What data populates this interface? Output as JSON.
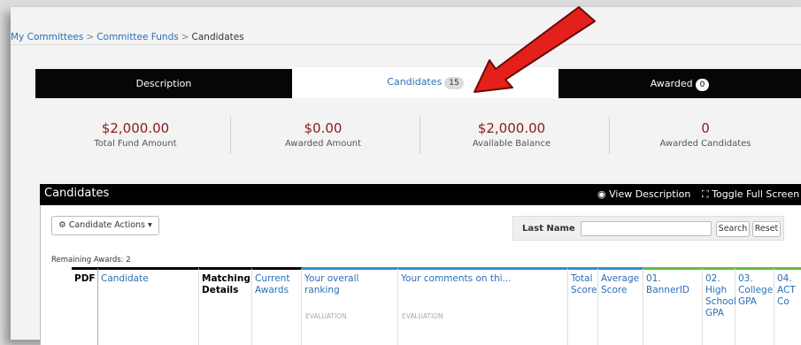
{
  "breadcrumb": {
    "items": [
      "My Committees",
      "Committee Funds",
      "Candidates"
    ],
    "separator": ">"
  },
  "tabs": [
    {
      "label": "Description",
      "badge": ""
    },
    {
      "label": "Candidates",
      "badge": "15"
    },
    {
      "label": "Awarded",
      "badge": "0"
    }
  ],
  "stats": [
    {
      "value": "$2,000.00",
      "label": "Total Fund Amount"
    },
    {
      "value": "$0.00",
      "label": "Awarded Amount"
    },
    {
      "value": "$2,000.00",
      "label": "Available Balance"
    },
    {
      "value": "0",
      "label": "Awarded Candidates"
    }
  ],
  "panel": {
    "title": "Candidates",
    "view_description": "View Description",
    "toggle_full_screen": "Toggle Full Screen",
    "candidate_actions": "Candidate Actions",
    "last_name_label": "Last Name",
    "last_name_value": "",
    "search_button": "Search",
    "reset_button": "Reset",
    "remaining_awards": "Remaining Awards: 2"
  },
  "columns": [
    {
      "label": "PDF",
      "sub": ""
    },
    {
      "label": "Candidate",
      "sub": ""
    },
    {
      "label": "Matching Details",
      "sub": ""
    },
    {
      "label": "Current Awards",
      "sub": ""
    },
    {
      "label": "Your overall ranking",
      "sub": "EVALUATION"
    },
    {
      "label": "Your comments on thi...",
      "sub": "EVALUATION"
    },
    {
      "label": "Total Score",
      "sub": ""
    },
    {
      "label": "Average Score",
      "sub": ""
    },
    {
      "label": "01. BannerID",
      "sub": ""
    },
    {
      "label": "02. High School GPA",
      "sub": ""
    },
    {
      "label": "03. College GPA",
      "sub": ""
    },
    {
      "label": "04. ACT Co",
      "sub": ""
    }
  ],
  "colors": {
    "accent_blue": "#2a6fb5",
    "money_red": "#8b1a1a",
    "annotation_arrow": "#e3201b"
  }
}
